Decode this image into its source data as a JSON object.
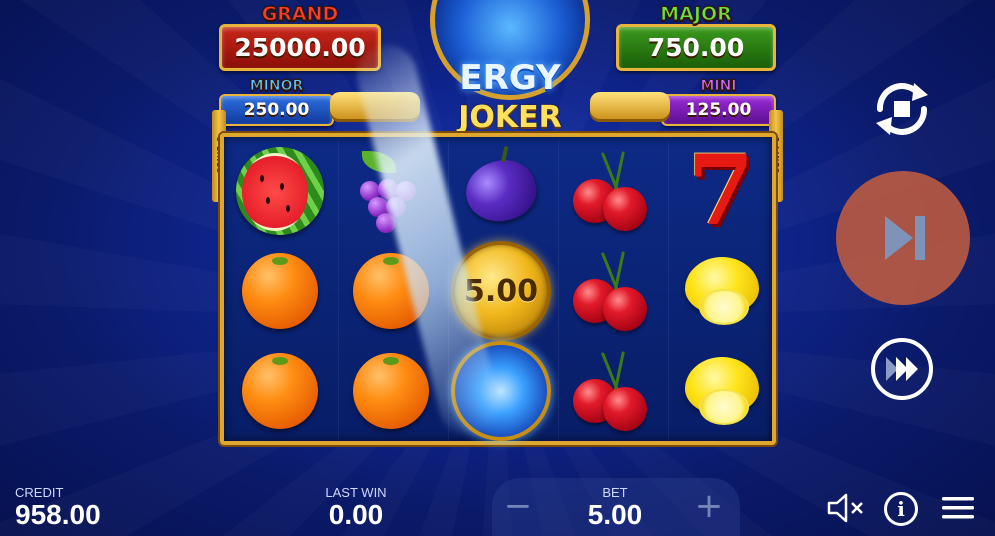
{
  "jackpots": {
    "grand": {
      "label": "GRAND",
      "value": "25000.00",
      "color": "#c8261a"
    },
    "major": {
      "label": "MAJOR",
      "value": "750.00",
      "color": "#3a9a1c"
    },
    "minor": {
      "label": "MINOR",
      "value": "250.00",
      "color": "#2d6fe0"
    },
    "mini": {
      "label": "MINI",
      "value": "125.00",
      "color": "#9b2ad8"
    }
  },
  "logo": {
    "line1": "ERGY",
    "line2": "JOKER"
  },
  "reels": {
    "lines_left": "5 LINES",
    "lines_right": "5 LINES",
    "columns": [
      [
        "watermelon",
        "orange",
        "orange"
      ],
      [
        "grapes",
        "orange",
        "orange"
      ],
      [
        "plum",
        "bonus-coin",
        "energy-orb"
      ],
      [
        "cherries",
        "cherries",
        "cherries"
      ],
      [
        "seven",
        "lemon",
        "lemon"
      ]
    ],
    "bonus_coin_value": "5.00",
    "seven_symbol": "7"
  },
  "controls": {
    "autoplay_icon": "autoplay-icon",
    "spin_icon": "skip-next-icon",
    "turbo_icon": "fast-forward-icon",
    "mute_icon": "speaker-muted-icon",
    "info_icon": "info-icon",
    "info_glyph": "i",
    "menu_icon": "hamburger-menu-icon",
    "spin_color": "#cd603c"
  },
  "bottom_bar": {
    "credit_label": "CREDIT",
    "credit_value": "958.00",
    "last_win_label": "LAST WIN",
    "last_win_value": "0.00",
    "bet_label": "BET",
    "bet_value": "5.00",
    "bet_minus": "−",
    "bet_plus": "+"
  }
}
